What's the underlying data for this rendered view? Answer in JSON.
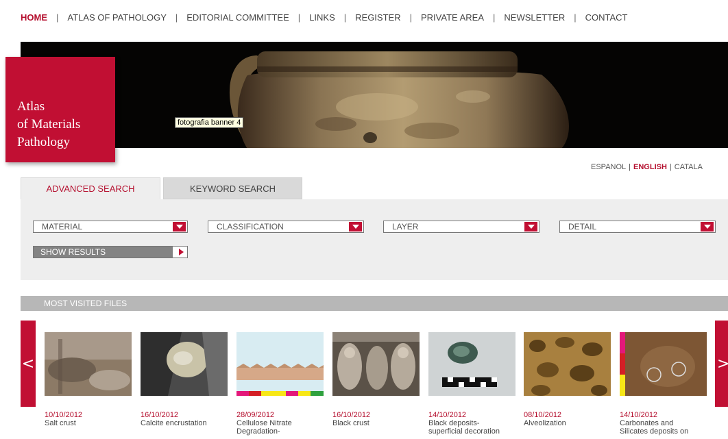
{
  "nav": {
    "items": [
      "HOME",
      "ATLAS OF PATHOLOGY",
      "EDITORIAL COMMITTEE",
      "LINKS",
      "REGISTER",
      "PRIVATE AREA",
      "NEWSLETTER",
      "CONTACT"
    ],
    "active": "HOME",
    "separator": "|"
  },
  "banner": {
    "tooltip": "fotografia banner 4"
  },
  "logo": {
    "line1": "Atlas",
    "line2": "of Materials",
    "line3": "Pathology"
  },
  "languages": {
    "items": [
      "ESPANOL",
      "ENGLISH",
      "CATALA"
    ],
    "active": "ENGLISH"
  },
  "search": {
    "tabs": [
      "ADVANCED SEARCH",
      "KEYWORD SEARCH"
    ],
    "active_tab": "ADVANCED SEARCH",
    "selects": {
      "material": "MATERIAL",
      "classification": "CLASSIFICATION",
      "layer": "LAYER",
      "detail": "DETAIL"
    },
    "show_results": "SHOW RESULTS"
  },
  "most_visited": {
    "title": "MOST VISITED FILES",
    "prev_arrow": "<",
    "next_arrow": ">",
    "cards": [
      {
        "date": "10/10/2012",
        "title": "Salt crust",
        "title2": ""
      },
      {
        "date": "16/10/2012",
        "title": "Calcite encrustation",
        "title2": ""
      },
      {
        "date": "28/09/2012",
        "title": "Cellulose Nitrate",
        "title2": "Degradation-"
      },
      {
        "date": "16/10/2012",
        "title": "Black crust",
        "title2": ""
      },
      {
        "date": "14/10/2012",
        "title": "Black deposits-",
        "title2": "superficial decoration"
      },
      {
        "date": "08/10/2012",
        "title": "Alveolization",
        "title2": ""
      },
      {
        "date": "14/10/2012",
        "title": "Carbonates and",
        "title2": "Silicates deposits on"
      }
    ]
  },
  "colors": {
    "brand_red": "#c10f33",
    "link_red": "#b5102f",
    "panel_gray": "#eeeeee",
    "bar_gray": "#b7b7b7"
  }
}
